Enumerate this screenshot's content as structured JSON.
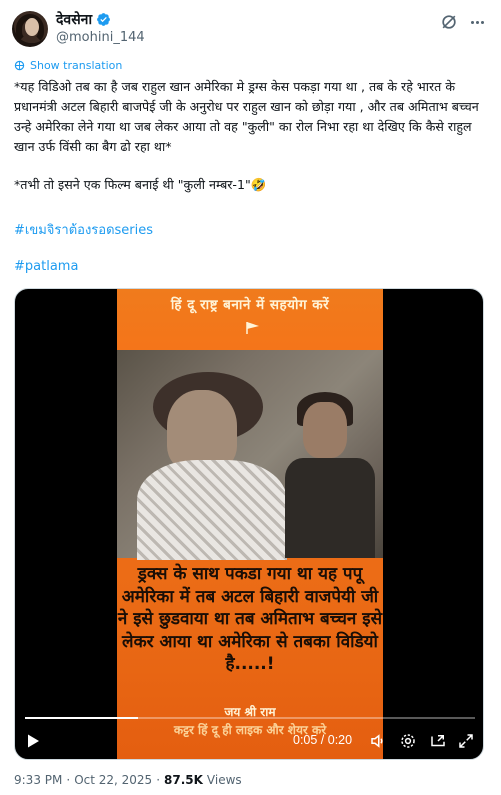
{
  "author": {
    "display_name": "देवसेना",
    "handle": "@mohini_144"
  },
  "translate_label": "Show translation",
  "tweet": {
    "paragraph1": "*यह विडिओ तब का है जब राहुल खान अमेरिका मे ड्रग्स केस पकड़ा गया था , तब के रहे भारत के प्रधानमंत्री अटल बिहारी बाजपेई जी के अनुरोध पर राहुल खान को छोड़ा गया , और तब अमिताभ बच्चन उन्हे अमेरिका लेने गया था जब लेकर आया तो वह \"कुली\" का रोल निभा रहा था देखिए कि कैसे राहुल खान उर्फ विंसी का बैग ढो रहा था*",
    "paragraph2": "*तभी तो इसने एक फिल्म बनाई थी \"कुली नम्बर-1\"🤣",
    "hashtag1": "#เขมจิราต้องรอดseries",
    "hashtag2": "#patlama"
  },
  "video": {
    "banner_top": "हिं दू राष्ट्र बनाने में सहयोग करें",
    "caption": "ड्रक्स के साथ पकडा गया था यह पपू अमेरिका में तब अटल बिहारी वाजपेयी जी ने इसे छुडवाया था तब अमिताभ बच्चन इसे लेकर आया था अमेरिका से तबका विडियो है.....!",
    "jai_text": "जय श्री राम",
    "bottom_text": "कट्टर हिं दू ही लाइक और शेयर करे",
    "time_display": "0:05 / 0:20",
    "progress_fraction": 0.25
  },
  "footer": {
    "time": "9:33 PM",
    "separator": "·",
    "date": "Oct 22, 2025",
    "views_count": "87.5K",
    "views_label": "Views"
  },
  "colors": {
    "link_blue": "#1d9bf0",
    "secondary_text": "#536471",
    "video_orange": "#f07b1c"
  }
}
